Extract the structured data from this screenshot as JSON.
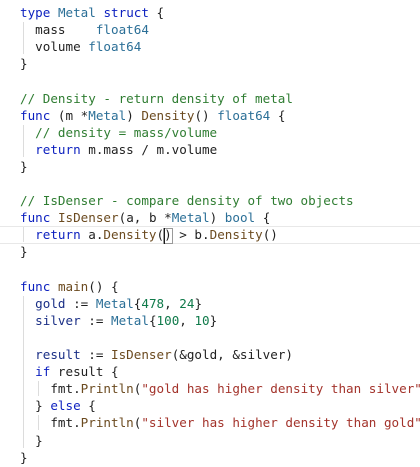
{
  "editor": {
    "language": "go",
    "colors": {
      "keyword": "#0b1fbf",
      "type": "#2b6f97",
      "function": "#6b4a1f",
      "comment": "#2f7d32",
      "string": "#a3332b",
      "number": "#0f7a4a",
      "identifier": "#1a2f86",
      "plain": "#1f1f1f"
    },
    "cursor": {
      "line": 13,
      "after_text": "return a.Density("
    },
    "matched_bracket": "(",
    "lines": [
      {
        "n": 1,
        "tokens": [
          {
            "t": "type",
            "c": "kw"
          },
          {
            "t": " ",
            "c": "plain"
          },
          {
            "t": "Metal",
            "c": "type"
          },
          {
            "t": " ",
            "c": "plain"
          },
          {
            "t": "struct",
            "c": "kw"
          },
          {
            "t": " {",
            "c": "plain"
          }
        ]
      },
      {
        "n": 2,
        "tokens": [
          {
            "t": "  mass    ",
            "c": "plain"
          },
          {
            "t": "float64",
            "c": "type"
          }
        ]
      },
      {
        "n": 3,
        "tokens": [
          {
            "t": "  volume ",
            "c": "plain"
          },
          {
            "t": "float64",
            "c": "type"
          }
        ]
      },
      {
        "n": 4,
        "tokens": [
          {
            "t": "}",
            "c": "plain"
          }
        ]
      },
      {
        "n": 5,
        "tokens": []
      },
      {
        "n": 6,
        "tokens": [
          {
            "t": "// Density - return density of metal",
            "c": "cm"
          }
        ]
      },
      {
        "n": 7,
        "tokens": [
          {
            "t": "func",
            "c": "kw"
          },
          {
            "t": " (m *",
            "c": "plain"
          },
          {
            "t": "Metal",
            "c": "type"
          },
          {
            "t": ") ",
            "c": "plain"
          },
          {
            "t": "Density",
            "c": "fn"
          },
          {
            "t": "() ",
            "c": "plain"
          },
          {
            "t": "float64",
            "c": "type"
          },
          {
            "t": " {",
            "c": "plain"
          }
        ]
      },
      {
        "n": 8,
        "tokens": [
          {
            "t": "  ",
            "c": "plain"
          },
          {
            "t": "// density = mass/volume",
            "c": "cm"
          }
        ]
      },
      {
        "n": 9,
        "tokens": [
          {
            "t": "  ",
            "c": "plain"
          },
          {
            "t": "return",
            "c": "kw"
          },
          {
            "t": " m.mass / m.volume",
            "c": "plain"
          }
        ]
      },
      {
        "n": 10,
        "tokens": [
          {
            "t": "}",
            "c": "plain"
          }
        ]
      },
      {
        "n": 11,
        "tokens": []
      },
      {
        "n": 12,
        "tokens": [
          {
            "t": "// IsDenser - compare density of two objects",
            "c": "cm"
          }
        ]
      },
      {
        "n": 13,
        "tokens": [
          {
            "t": "func",
            "c": "kw"
          },
          {
            "t": " ",
            "c": "plain"
          },
          {
            "t": "IsDenser",
            "c": "fn"
          },
          {
            "t": "(a, b *",
            "c": "plain"
          },
          {
            "t": "Metal",
            "c": "type"
          },
          {
            "t": ") ",
            "c": "plain"
          },
          {
            "t": "bool",
            "c": "type"
          },
          {
            "t": " {",
            "c": "plain"
          }
        ]
      },
      {
        "n": 14,
        "tokens": [
          {
            "t": "  ",
            "c": "plain"
          },
          {
            "t": "return",
            "c": "kw"
          },
          {
            "t": " a.",
            "c": "plain"
          },
          {
            "t": "Density",
            "c": "fn"
          },
          {
            "t": "(",
            "c": "plain",
            "id": "cursor-anchor"
          },
          {
            "t": ")",
            "c": "plain",
            "id": "bracket-char"
          },
          {
            "t": " > b.",
            "c": "plain"
          },
          {
            "t": "Density",
            "c": "fn"
          },
          {
            "t": "()",
            "c": "plain"
          }
        ]
      },
      {
        "n": 15,
        "tokens": [
          {
            "t": "}",
            "c": "plain"
          }
        ]
      },
      {
        "n": 16,
        "tokens": []
      },
      {
        "n": 17,
        "tokens": [
          {
            "t": "func",
            "c": "kw"
          },
          {
            "t": " ",
            "c": "plain"
          },
          {
            "t": "main",
            "c": "fn"
          },
          {
            "t": "() {",
            "c": "plain"
          }
        ]
      },
      {
        "n": 18,
        "tokens": [
          {
            "t": "  ",
            "c": "plain"
          },
          {
            "t": "gold",
            "c": "id"
          },
          {
            "t": " := ",
            "c": "plain"
          },
          {
            "t": "Metal",
            "c": "type"
          },
          {
            "t": "{",
            "c": "plain"
          },
          {
            "t": "478",
            "c": "num"
          },
          {
            "t": ", ",
            "c": "plain"
          },
          {
            "t": "24",
            "c": "num"
          },
          {
            "t": "}",
            "c": "plain"
          }
        ]
      },
      {
        "n": 19,
        "tokens": [
          {
            "t": "  ",
            "c": "plain"
          },
          {
            "t": "silver",
            "c": "id"
          },
          {
            "t": " := ",
            "c": "plain"
          },
          {
            "t": "Metal",
            "c": "type"
          },
          {
            "t": "{",
            "c": "plain"
          },
          {
            "t": "100",
            "c": "num"
          },
          {
            "t": ", ",
            "c": "plain"
          },
          {
            "t": "10",
            "c": "num"
          },
          {
            "t": "}",
            "c": "plain"
          }
        ]
      },
      {
        "n": 20,
        "tokens": []
      },
      {
        "n": 21,
        "tokens": [
          {
            "t": "  ",
            "c": "plain"
          },
          {
            "t": "result",
            "c": "id"
          },
          {
            "t": " := ",
            "c": "plain"
          },
          {
            "t": "IsDenser",
            "c": "fn"
          },
          {
            "t": "(&gold, &silver)",
            "c": "plain"
          }
        ]
      },
      {
        "n": 22,
        "tokens": [
          {
            "t": "  ",
            "c": "plain"
          },
          {
            "t": "if",
            "c": "kw"
          },
          {
            "t": " result {",
            "c": "plain"
          }
        ]
      },
      {
        "n": 23,
        "tokens": [
          {
            "t": "    fmt.",
            "c": "plain"
          },
          {
            "t": "Println",
            "c": "fn"
          },
          {
            "t": "(",
            "c": "plain"
          },
          {
            "t": "\"gold has higher density than silver\"",
            "c": "str"
          },
          {
            "t": ")",
            "c": "plain"
          }
        ]
      },
      {
        "n": 24,
        "tokens": [
          {
            "t": "  } ",
            "c": "plain"
          },
          {
            "t": "else",
            "c": "kw"
          },
          {
            "t": " {",
            "c": "plain"
          }
        ]
      },
      {
        "n": 25,
        "tokens": [
          {
            "t": "    fmt.",
            "c": "plain"
          },
          {
            "t": "Println",
            "c": "fn"
          },
          {
            "t": "(",
            "c": "plain"
          },
          {
            "t": "\"silver has higher density than gold\"",
            "c": "str"
          },
          {
            "t": ")",
            "c": "plain"
          }
        ]
      },
      {
        "n": 26,
        "tokens": [
          {
            "t": "  }",
            "c": "plain"
          }
        ]
      },
      {
        "n": 27,
        "tokens": [
          {
            "t": "}",
            "c": "plain"
          }
        ]
      }
    ]
  }
}
